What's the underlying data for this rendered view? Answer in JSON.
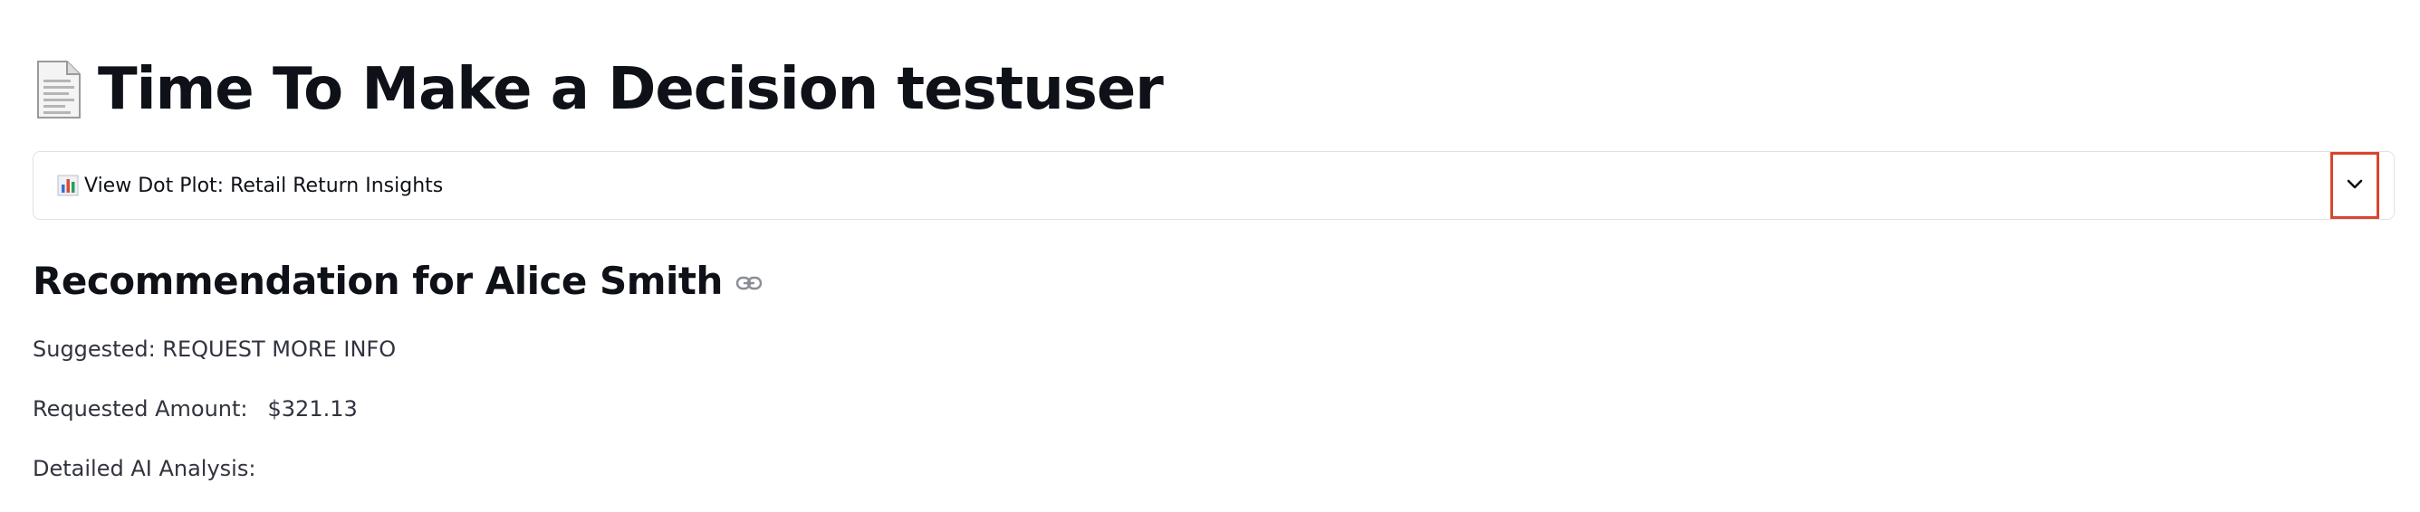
{
  "header": {
    "title_icon": "document-icon",
    "title": "Time To Make a Decision testuser"
  },
  "expander": {
    "icon": "bar-chart-icon",
    "label": "View Dot Plot: Retail Return Insights",
    "toggle_icon": "chevron-down-icon"
  },
  "recommendation": {
    "heading": "Recommendation for Alice Smith",
    "suggested_label": "Suggested: REQUEST MORE INFO",
    "amount_label": "Requested Amount:",
    "amount_value": "$321.13",
    "analysis_label": "Detailed AI Analysis:"
  },
  "colors": {
    "title_text": "#0e1117",
    "body_text": "#31333f",
    "border": "#dfe1e6",
    "highlight_border": "#d9452e"
  }
}
